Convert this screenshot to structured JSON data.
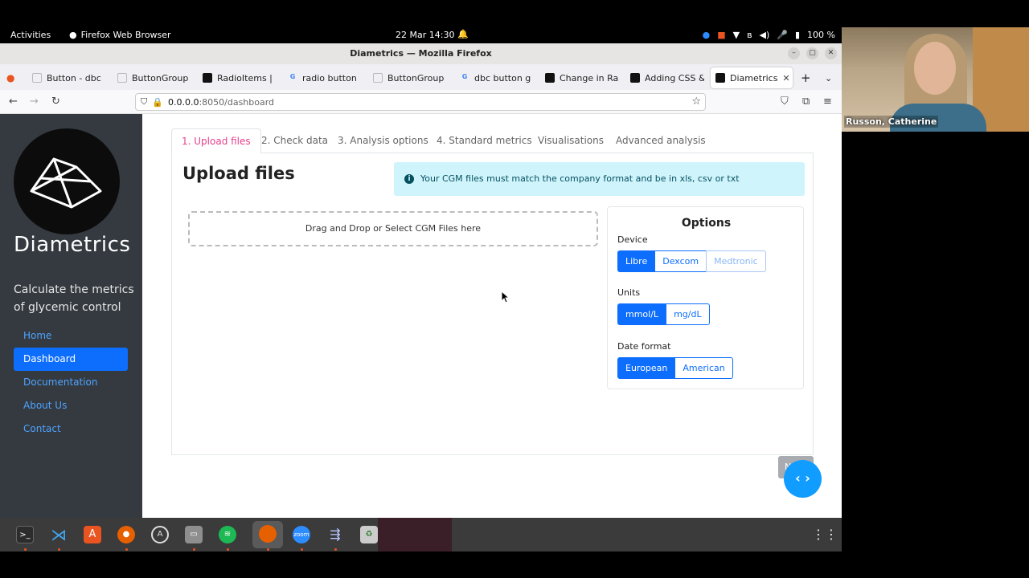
{
  "topbar": {
    "activities": "Activities",
    "app_name": "Firefox Web Browser",
    "clock": "22 Mar  14:30",
    "battery": "100 %"
  },
  "window": {
    "title": "Diametrics — Mozilla Firefox"
  },
  "browser_tabs": [
    {
      "label": "Button - dbc",
      "icon": "page-icon"
    },
    {
      "label": "ButtonGroup",
      "icon": "page-icon"
    },
    {
      "label": "RadioItems |",
      "icon": "dash-icon"
    },
    {
      "label": "radio button",
      "icon": "google-icon"
    },
    {
      "label": "ButtonGroup",
      "icon": "page-icon"
    },
    {
      "label": "dbc button g",
      "icon": "google-icon"
    },
    {
      "label": "Change in Ra",
      "icon": "dash-icon"
    },
    {
      "label": "Adding CSS &",
      "icon": "dash-icon"
    },
    {
      "label": "Diametrics",
      "icon": "dash-icon",
      "active": true
    }
  ],
  "address": {
    "host": "0.0.0.0",
    "path": ":8050/dashboard"
  },
  "sidebar": {
    "brand": "Diametrics",
    "tagline": "Calculate the metrics of glycemic control",
    "items": [
      {
        "label": "Home"
      },
      {
        "label": "Dashboard",
        "active": true
      },
      {
        "label": "Documentation"
      },
      {
        "label": "About Us"
      },
      {
        "label": "Contact"
      }
    ]
  },
  "page_tabs": [
    {
      "label": "1. Upload files",
      "active": true
    },
    {
      "label": "2. Check data"
    },
    {
      "label": "3. Analysis options"
    },
    {
      "label": "4. Standard metrics"
    },
    {
      "label": "Visualisations"
    },
    {
      "label": "Advanced analysis"
    }
  ],
  "upload": {
    "title": "Upload files",
    "alert": "Your CGM files must match the company format and be in xls, csv or txt",
    "dropzone": "Drag and Drop or Select CGM Files here"
  },
  "options": {
    "title": "Options",
    "device": {
      "label": "Device",
      "buttons": [
        "Libre",
        "Dexcom",
        "Medtronic"
      ],
      "selected": "Libre"
    },
    "units": {
      "label": "Units",
      "buttons": [
        "mmol/L",
        "mg/dL"
      ],
      "selected": "mmol/L"
    },
    "date_format": {
      "label": "Date format",
      "buttons": [
        "European",
        "American"
      ],
      "selected": "European"
    }
  },
  "next_button": "N",
  "webcam": {
    "participant": "Russon, Catherine"
  },
  "colors": {
    "primary": "#0d6efd",
    "sidebar_bg": "#343a40",
    "active_tab_text": "#e83e8c",
    "alert_bg": "#cff4fc",
    "dash_dev_button": "#119dff"
  }
}
